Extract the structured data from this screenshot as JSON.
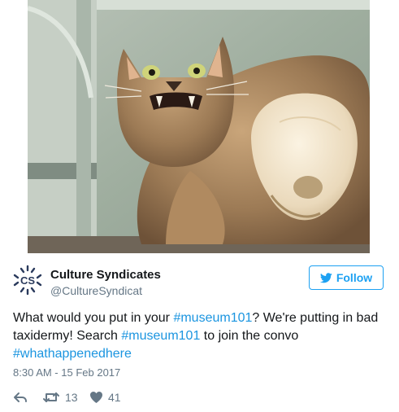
{
  "tweet": {
    "author_name": "Culture Syndicates",
    "author_handle": "@CultureSyndicat",
    "follow_label": "Follow",
    "text_parts": {
      "p1": "What would you put in your ",
      "h1": "#museum101",
      "p2": "? We're putting in bad taxidermy! Search ",
      "h2": "#museum101",
      "p3": " to join the convo ",
      "h3": "#whathappenedhere"
    },
    "timestamp": "8:30 AM - 15 Feb 2017",
    "retweet_count": "13",
    "like_count": "41",
    "avatar_text": "CS"
  },
  "colors": {
    "accent": "#1da1f2",
    "hashtag": "#1b95e0",
    "muted": "#657786",
    "text": "#14171a",
    "avatar": "#2a3a5c"
  },
  "icons": [
    "reply-icon",
    "retweet-icon",
    "heart-icon",
    "twitter-bird-icon"
  ]
}
